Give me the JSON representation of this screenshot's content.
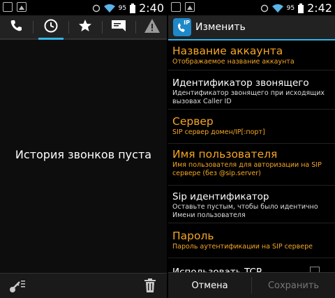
{
  "left": {
    "status": {
      "battery": "95",
      "time": "2:40"
    },
    "tabs": [
      "phone-icon",
      "clock-icon",
      "star-icon",
      "message-icon",
      "warning-icon"
    ],
    "empty_message": "История звонков пуста"
  },
  "right": {
    "status": {
      "battery": "95",
      "time": "2:42"
    },
    "app_icon_text": "IP",
    "title": "Изменить",
    "prefs": [
      {
        "title": "Название аккаунта",
        "summary": "Отображаемое название аккаунта"
      },
      {
        "title": "Идентификатор звонящего",
        "summary": "Идентификатор звонящего при исходящих вызовах Caller ID"
      },
      {
        "title": "Сервер",
        "summary": "SIP сервер домен/IP[:порт]"
      },
      {
        "title": "Имя пользователя",
        "summary": "Имя пользователя для авторизации на SIP сервере (без @sip.server)"
      },
      {
        "title": "Sip идентификатор",
        "summary": "Оставьте пустым, чтобы было идентично Имени пользователя"
      },
      {
        "title": "Пароль",
        "summary": "Пароль аутентификации на SIP сервере"
      },
      {
        "title": "Использовать TCP",
        "summary": ""
      }
    ],
    "cancel": "Отмена",
    "save": "Сохранить"
  }
}
